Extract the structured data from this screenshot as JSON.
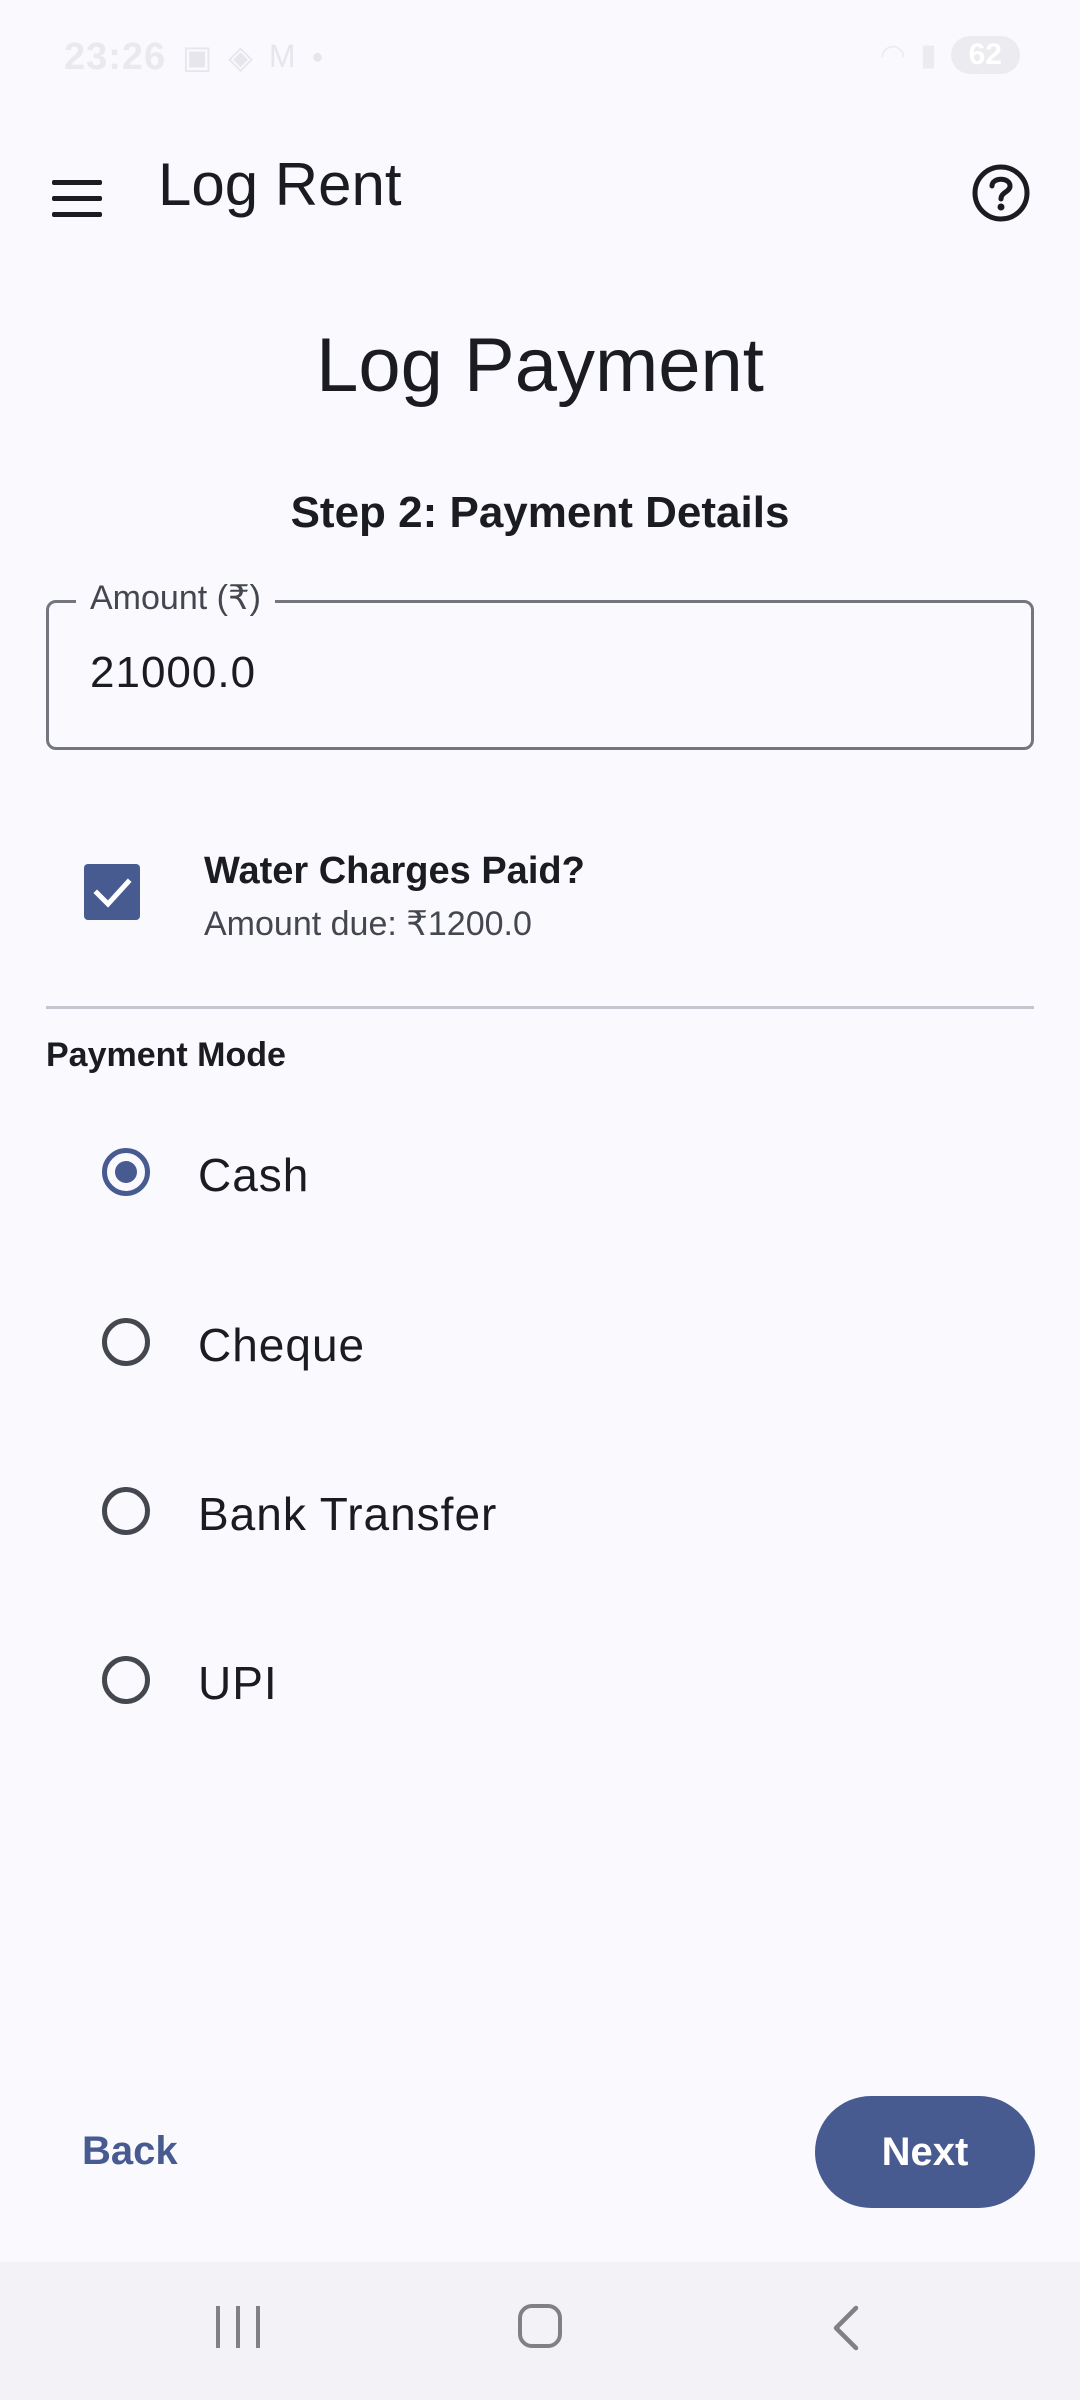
{
  "status_bar": {
    "time": "23:26",
    "left_icons": [
      "screenshot-icon",
      "sync-icon",
      "gmail-icon",
      "dot-icon"
    ],
    "battery": "62"
  },
  "app_bar": {
    "title": "Log Rent"
  },
  "page": {
    "title": "Log Payment",
    "step": "Step 2: Payment Details"
  },
  "amount_field": {
    "label": "Amount (₹)",
    "value": "21000.0"
  },
  "water_charges": {
    "checked": true,
    "title": "Water Charges Paid?",
    "subtitle": "Amount due: ₹1200.0"
  },
  "payment_mode": {
    "label": "Payment Mode",
    "options": [
      {
        "label": "Cash",
        "selected": true
      },
      {
        "label": "Cheque",
        "selected": false
      },
      {
        "label": "Bank Transfer",
        "selected": false
      },
      {
        "label": "UPI",
        "selected": false
      }
    ]
  },
  "actions": {
    "back": "Back",
    "next": "Next"
  },
  "colors": {
    "accent": "#485b91",
    "background": "#f9f9fe",
    "text": "#1b1c21"
  }
}
